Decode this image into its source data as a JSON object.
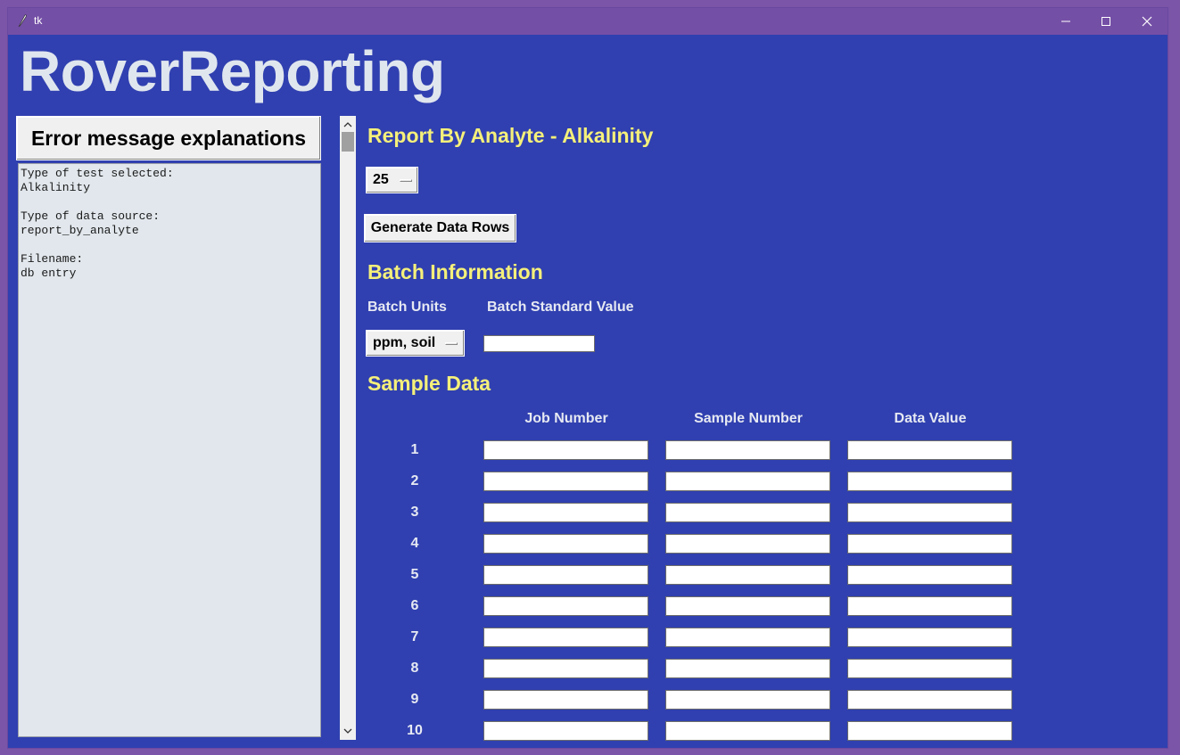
{
  "window": {
    "title": "tk",
    "icon": "feather-icon"
  },
  "app_title": "RoverReporting",
  "sidebar": {
    "error_button_label": "Error message explanations",
    "info_text": "Type of test selected:\nAlkalinity\n\nType of data source:\nreport_by_analyte\n\nFilename:\ndb entry"
  },
  "main": {
    "heading": "Report By Analyte - Alkalinity",
    "row_count_value": "25",
    "generate_button_label": "Generate Data Rows",
    "batch": {
      "heading": "Batch Information",
      "units_label": "Batch Units",
      "standard_label": "Batch Standard Value",
      "units_value": "ppm, soil",
      "standard_value": ""
    },
    "sample": {
      "heading": "Sample Data",
      "columns": [
        "Job Number",
        "Sample Number",
        "Data Value"
      ],
      "rows": [
        "1",
        "2",
        "3",
        "4",
        "5",
        "6",
        "7",
        "8",
        "9",
        "10"
      ]
    }
  },
  "colors": {
    "background": "#3040b0",
    "titlebar": "#744fa6",
    "heading_yellow": "#f5f07a",
    "app_title": "#e0e6ee"
  }
}
